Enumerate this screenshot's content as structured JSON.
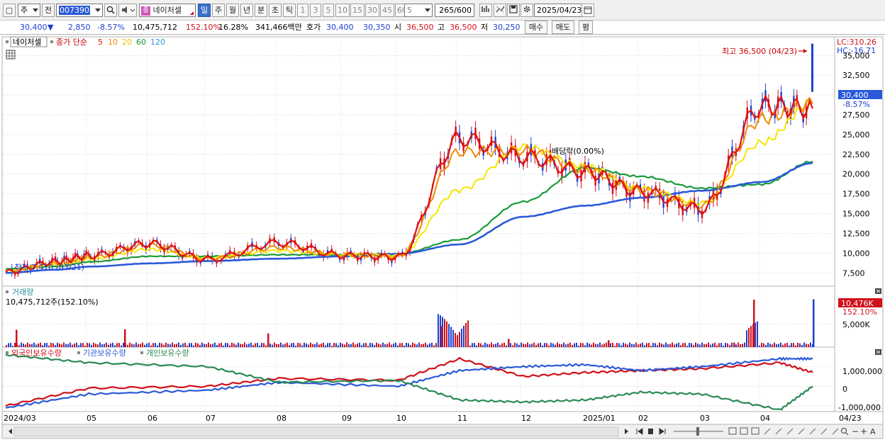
{
  "toolbar": {
    "market_label": "주",
    "prev_label": "전",
    "code": "007390",
    "stock_name": "네이처셀",
    "periods": [
      "일",
      "주",
      "월",
      "년",
      "분",
      "초",
      "틱"
    ],
    "intervals": [
      "1",
      "3",
      "5",
      "10",
      "15",
      "30",
      "45",
      "60"
    ],
    "interval_value": "5",
    "count_value": "265",
    "count_total": "/600",
    "date_value": "2025/04/23"
  },
  "quote": {
    "price": "30,400",
    "change": "2,850",
    "change_pct": "-8.57%",
    "volume": "10,475,712",
    "volume_ratio": "152.10%",
    "turnover": "16.28%",
    "amount": "341,466백만",
    "ask_label": "호가",
    "ask": "30,400",
    "bid": "30,350",
    "open_label": "시",
    "open": "36,500",
    "high_label": "고",
    "high": "36,500",
    "low_label": "저",
    "low": "30,250",
    "buy_label": "매수",
    "sell_label": "매도",
    "eval_label": "평"
  },
  "price_pane": {
    "name": "네이처셀",
    "ma_label": "종가 단순",
    "ma_periods": [
      "5",
      "10",
      "20",
      "60",
      "120"
    ],
    "lc": "LC:310.26",
    "hc": "HC:-16.71",
    "high_note": "최고 36,500 (04/23)",
    "low_note": "최저 7,410 (03/21)",
    "div_note": "배당락(0.00%)",
    "cur_price": "30,400",
    "cur_pct": "-8.57%",
    "yticks": [
      "35,000",
      "32,500",
      "30,000",
      "27,500",
      "25,000",
      "22,500",
      "20,000",
      "17,500",
      "15,000",
      "12,500",
      "10,000",
      "7,500"
    ]
  },
  "volume_pane": {
    "title": "거래량",
    "value": "10,475,712주(152.10%)",
    "cur_value": "10,476K",
    "cur_pct": "152.10%",
    "ytick": "5,000K"
  },
  "holding_pane": {
    "labels": [
      "외국인보유수량",
      "기관보유수량",
      "개인보유수량"
    ],
    "yticks": [
      "1,000,000",
      "0",
      "-1,000,000"
    ]
  },
  "xaxis": {
    "labels": [
      "2024/03",
      "05",
      "06",
      "07",
      "08",
      "09",
      "10",
      "11",
      "12",
      "2025/01",
      "02",
      "03",
      "04",
      "04/23"
    ]
  },
  "colors": {
    "up": "#d0101b",
    "down": "#1f3fcf",
    "ma5": "#e01010",
    "ma10": "#f08a00",
    "ma20": "#f5e600",
    "ma60": "#1a9a3a",
    "ma120": "#2a5ad8",
    "foreign": "#d0101b",
    "institution": "#2a5ad8",
    "individual": "#2a8a55"
  },
  "chart_data": [
    {
      "type": "line",
      "title": "네이처셀",
      "ylim": [
        6000,
        37000
      ],
      "x": [
        "2024/03",
        "2024/04",
        "2024/05",
        "2024/06",
        "2024/07",
        "2024/08",
        "2024/09",
        "2024/10",
        "2024/11",
        "2024/12",
        "2025/01",
        "2025/02",
        "2025/03",
        "2025/04",
        "04/23"
      ],
      "series": [
        {
          "name": "5",
          "values": [
            7600,
            8900,
            9700,
            11200,
            9200,
            11300,
            9700,
            9500,
            24500,
            22200,
            20300,
            17800,
            15600,
            28600,
            28300
          ]
        },
        {
          "name": "10",
          "values": [
            7700,
            8700,
            9500,
            11000,
            9300,
            10700,
            9800,
            9600,
            22800,
            23000,
            20600,
            18000,
            16000,
            27000,
            28900
          ]
        },
        {
          "name": "20",
          "values": [
            7800,
            8500,
            9300,
            10500,
            9400,
            10300,
            9800,
            9700,
            18000,
            23500,
            21000,
            18200,
            16300,
            24000,
            29000
          ]
        },
        {
          "name": "60",
          "values": [
            8000,
            8300,
            8900,
            9600,
            9600,
            9800,
            9800,
            9900,
            11700,
            16500,
            20800,
            19700,
            18200,
            18700,
            21600
          ]
        },
        {
          "name": "120",
          "values": [
            7500,
            7900,
            8300,
            8700,
            9000,
            9300,
            9600,
            9900,
            11100,
            14600,
            16000,
            17000,
            17900,
            19000,
            21400
          ]
        }
      ]
    },
    {
      "type": "bar",
      "title": "거래량",
      "categories": [
        "2024/03",
        "2024/05",
        "2024/08",
        "2024/11",
        "2024/12",
        "2025/01",
        "2025/03",
        "2025/04",
        "04/23"
      ],
      "values": [
        3800,
        3900,
        3000,
        4600,
        1800,
        1500,
        1000,
        10400,
        10476
      ],
      "ylim": [
        0,
        11500
      ]
    },
    {
      "type": "line",
      "ylim": [
        -1250000,
        1850000
      ],
      "x": [
        "2024/03",
        "2024/05",
        "2024/07",
        "2024/08",
        "2024/10",
        "2024/11",
        "2024/12",
        "2025/01",
        "2025/02",
        "2025/03",
        "2025/04",
        "04/23"
      ],
      "series": [
        {
          "name": "외국인보유수량",
          "values": [
            -1000000,
            -100000,
            0,
            400000,
            300000,
            1400000,
            500000,
            700000,
            800000,
            900000,
            1200000,
            700000
          ]
        },
        {
          "name": "기관보유수량",
          "values": [
            -1100000,
            -400000,
            -200000,
            200000,
            0,
            800000,
            1000000,
            1100000,
            800000,
            1000000,
            1400000,
            1400000
          ]
        },
        {
          "name": "개인보유수량",
          "values": [
            1600000,
            1200000,
            1000000,
            200000,
            300000,
            -700000,
            -800000,
            -700000,
            -300000,
            -400000,
            -1200000,
            0
          ]
        }
      ]
    }
  ]
}
